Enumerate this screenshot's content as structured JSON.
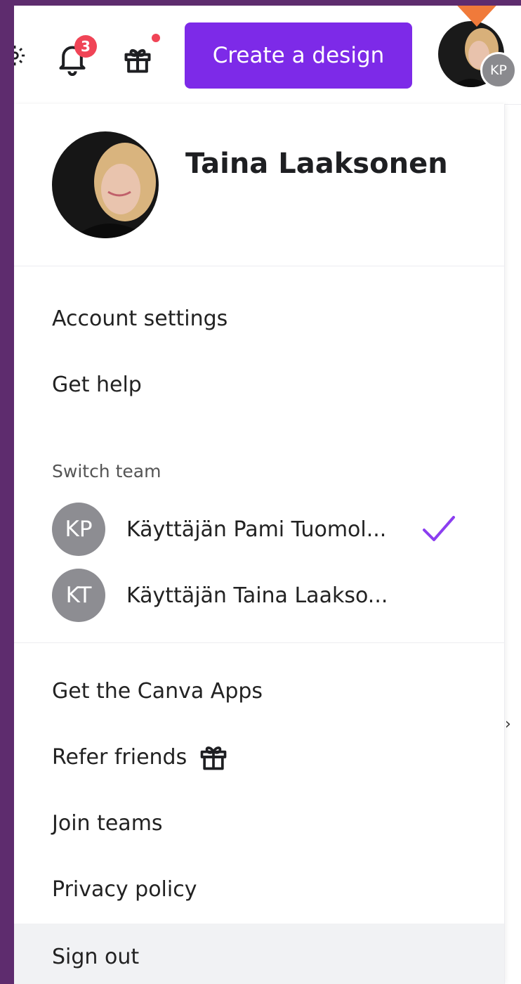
{
  "topbar": {
    "notification_count": "3",
    "create_button_label": "Create a design",
    "account_initials": "KP",
    "icons": [
      "settings-icon",
      "bell-icon",
      "gift-icon"
    ]
  },
  "profile": {
    "name": "Taina Laaksonen"
  },
  "menu": {
    "account_settings": "Account settings",
    "get_help": "Get help",
    "switch_team_label": "Switch team",
    "teams": [
      {
        "initials": "KP",
        "name": "Käyttäjän Pami Tuomol...",
        "selected": true
      },
      {
        "initials": "KT",
        "name": "Käyttäjän Taina Laakso...",
        "selected": false
      }
    ],
    "get_apps": "Get the Canva Apps",
    "refer_friends": "Refer friends",
    "join_teams": "Join teams",
    "privacy_policy": "Privacy policy",
    "sign_out": "Sign out"
  },
  "colors": {
    "brand_purple": "#7d2ae8",
    "badge_red": "#f04456",
    "background": "#5e2c6e"
  }
}
